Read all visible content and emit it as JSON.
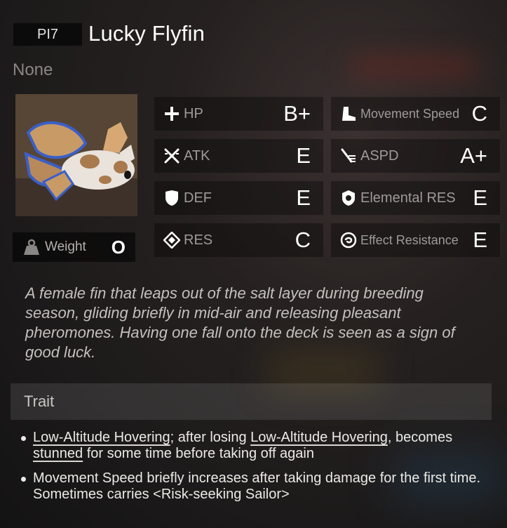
{
  "header": {
    "code": "PI7",
    "title": "Lucky Flyfin",
    "subtitle": "None"
  },
  "weight": {
    "label": "Weight",
    "value": "O",
    "icon": "weight-icon"
  },
  "stats": {
    "hp": {
      "label": "HP",
      "grade": "B+",
      "icon": "plus-icon"
    },
    "atk": {
      "label": "ATK",
      "grade": "E",
      "icon": "crossed-swords-icon"
    },
    "def": {
      "label": "DEF",
      "grade": "E",
      "icon": "shield-icon"
    },
    "res": {
      "label": "RES",
      "grade": "C",
      "icon": "diamond-icon"
    },
    "movement_speed": {
      "label": "Movement Speed",
      "grade": "C",
      "icon": "boot-icon"
    },
    "aspd": {
      "label": "ASPD",
      "grade": "A+",
      "icon": "fast-attack-icon"
    },
    "elemental_res": {
      "label": "Elemental RES",
      "grade": "E",
      "icon": "elemental-shield-icon"
    },
    "effect_resistance": {
      "label": "Effect Resistance",
      "grade": "E",
      "icon": "swirl-icon"
    }
  },
  "description": "A female fin that leaps out of the salt layer during breeding season, gliding briefly in mid-air and releasing pleasant pheromones. Having one fall onto the deck is seen as a sign of good luck.",
  "trait": {
    "heading": "Trait",
    "bullet1": {
      "kw1": "Low-Altitude Hovering",
      "t1": "; after losing ",
      "kw2": "Low-Altitude Hovering",
      "t2": ", becomes ",
      "kw3": "stunned",
      "t3": " for some time before taking off again"
    },
    "bullet2": "Movement Speed briefly increases after taking damage for the first time. Sometimes carries <Risk-seeking Sailor>"
  },
  "colors": {
    "text": "#ffffff",
    "label": "#9e9a97",
    "fish_blue": "#3a5fc8",
    "fish_tan": "#c99a66"
  }
}
